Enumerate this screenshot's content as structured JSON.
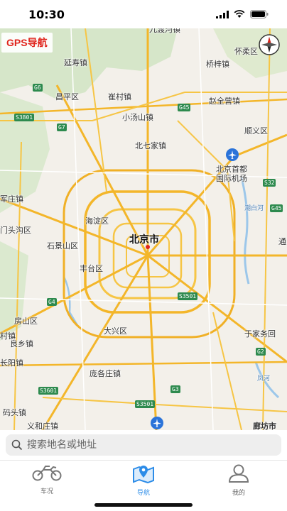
{
  "status_bar": {
    "time": "10:30",
    "icons": [
      "signal-icon",
      "wifi-icon",
      "battery-icon"
    ]
  },
  "map": {
    "app_badge": "GPS导航",
    "city": "北京市",
    "labels": [
      {
        "text": "九渡河镇"
      },
      {
        "text": "怀柔区"
      },
      {
        "text": "延寿镇"
      },
      {
        "text": "桥梓镇"
      },
      {
        "text": "昌平区"
      },
      {
        "text": "崔村镇"
      },
      {
        "text": "赵全营镇"
      },
      {
        "text": "小汤山镇"
      },
      {
        "text": "顺义区"
      },
      {
        "text": "北七家镇"
      },
      {
        "text": "北京首都"
      },
      {
        "text": "国际机场"
      },
      {
        "text": "军庄镇"
      },
      {
        "text": "海淀区"
      },
      {
        "text": "门头沟区"
      },
      {
        "text": "石景山区"
      },
      {
        "text": "潮白河"
      },
      {
        "text": "丰台区"
      },
      {
        "text": "房山区"
      },
      {
        "text": "大兴区"
      },
      {
        "text": "于家务回"
      },
      {
        "text": "良乡镇"
      },
      {
        "text": "村镇"
      },
      {
        "text": "庞各庄镇"
      },
      {
        "text": "凤河"
      },
      {
        "text": "长阳镇"
      },
      {
        "text": "码头镇"
      },
      {
        "text": "义和庄镇"
      },
      {
        "text": "廊坊市"
      },
      {
        "text": "通"
      }
    ],
    "road_badges": [
      "G6",
      "G45",
      "S3801",
      "G7",
      "S32",
      "G45",
      "S3501",
      "G4",
      "G2",
      "G3",
      "S3601",
      "S3501"
    ],
    "accent_color": "#e0241b"
  },
  "search": {
    "placeholder": "搜索地名或地址"
  },
  "tabs": [
    {
      "label": "车况",
      "icon": "motorcycle-icon",
      "active": false
    },
    {
      "label": "导航",
      "icon": "map-pin-icon",
      "active": true
    },
    {
      "label": "我的",
      "icon": "user-icon",
      "active": false
    }
  ],
  "colors": {
    "active_tab": "#2c8ce8",
    "inactive_tab": "#666666",
    "badge_text": "#e0241b"
  }
}
